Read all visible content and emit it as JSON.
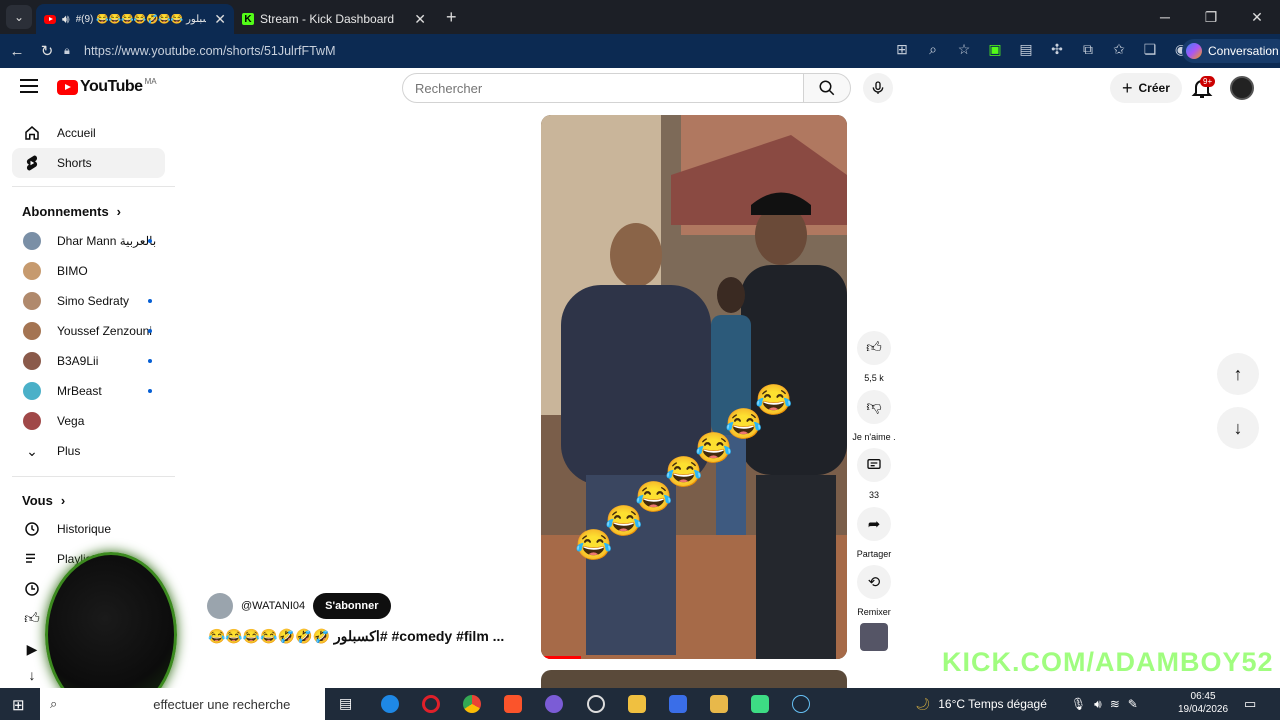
{
  "browser": {
    "tabs": [
      {
        "title": "#اكسبلور 😂😂🤣😂😂😂😂 (9)",
        "active": true
      },
      {
        "title": "Stream - Kick Dashboard",
        "active": false
      }
    ],
    "url": "https://www.youtube.com/shorts/51JulrfFTwM",
    "conversation_label": "Conversation"
  },
  "youtube": {
    "logo_text": "YouTube",
    "country_code": "MA",
    "search_placeholder": "Rechercher",
    "create_label": "Créer",
    "notifications_badge": "9+"
  },
  "sidebar": {
    "main": [
      {
        "label": "Accueil",
        "icon": "home-icon"
      },
      {
        "label": "Shorts",
        "icon": "shorts-icon",
        "active": true
      }
    ],
    "subscriptions_title": "Abonnements",
    "subscriptions": [
      {
        "name": "Dhar Mann بالعربية",
        "new": true,
        "color": "#7a8fa6"
      },
      {
        "name": "BIMO",
        "new": false,
        "color": "#c69a6e"
      },
      {
        "name": "Simo Sedraty",
        "new": true,
        "color": "#b0896c"
      },
      {
        "name": "Youssef Zenzouni",
        "new": true,
        "color": "#a47452"
      },
      {
        "name": "B3A9Lii",
        "new": true,
        "color": "#8a5a4a"
      },
      {
        "name": "MrBeast",
        "new": true,
        "color": "#4ab0c8"
      },
      {
        "name": "Vega",
        "new": false,
        "color": "#a04848"
      }
    ],
    "more_label": "Plus",
    "you_title": "Vous",
    "you_items": [
      {
        "label": "Historique",
        "icon": "history-icon"
      },
      {
        "label": "Playlists",
        "icon": "playlist-icon"
      }
    ]
  },
  "short": {
    "channel": "@WATANI04",
    "subscribe_label": "S'abonner",
    "caption": "😂😂😂😂🤣🤣🤣 اكسبلور# #comedy #film ...",
    "actions": [
      {
        "label": "5,5 k",
        "icon": "thumbs-up-icon"
      },
      {
        "label": "Je n'aime .",
        "icon": "thumbs-down-icon"
      },
      {
        "label": "33",
        "icon": "comment-icon"
      },
      {
        "label": "Partager",
        "icon": "share-icon"
      },
      {
        "label": "Remixer",
        "icon": "remix-icon"
      }
    ],
    "progress": 0.13
  },
  "watermark": "KICK.COM/ADAMBOY52",
  "taskbar": {
    "search_placeholder": "effectuer une recherche",
    "weather": "16°C  Temps dégagé",
    "time": "06:45",
    "date": "19/04/2026"
  }
}
